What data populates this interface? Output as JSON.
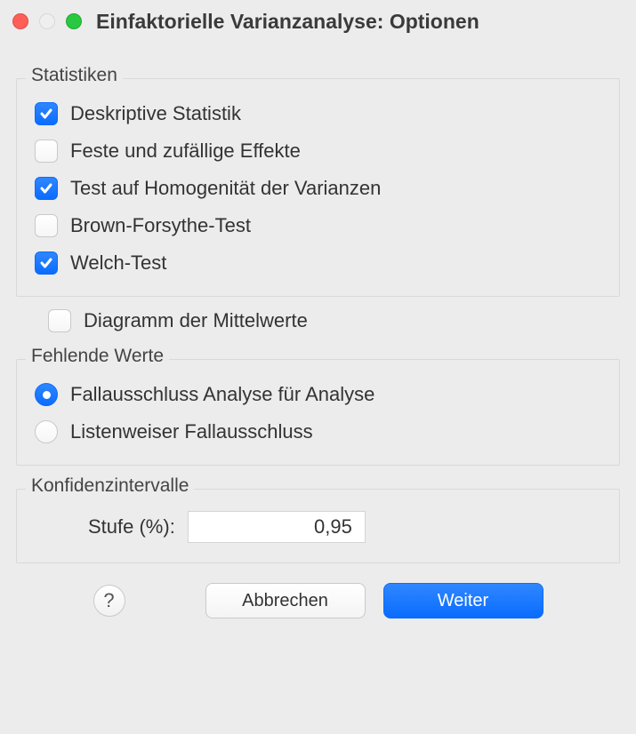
{
  "window": {
    "title": "Einfaktorielle Varianzanalyse: Optionen"
  },
  "groups": {
    "statistics": {
      "label": "Statistiken",
      "options": {
        "descriptive": {
          "label": "Deskriptive Statistik",
          "checked": true
        },
        "fixed_random": {
          "label": "Feste und zufällige Effekte",
          "checked": false
        },
        "homogeneity": {
          "label": "Test auf Homogenität der Varianzen",
          "checked": true
        },
        "brown_forsythe": {
          "label": "Brown-Forsythe-Test",
          "checked": false
        },
        "welch": {
          "label": "Welch-Test",
          "checked": true
        }
      }
    },
    "means_plot": {
      "label": "Diagramm der Mittelwerte",
      "checked": false
    },
    "missing": {
      "label": "Fehlende Werte",
      "options": {
        "analysis_by_analysis": {
          "label": "Fallausschluss Analyse für Analyse",
          "checked": true
        },
        "listwise": {
          "label": "Listenweiser Fallausschluss",
          "checked": false
        }
      }
    },
    "confidence": {
      "label": "Konfidenzintervalle",
      "level_label": "Stufe (%):",
      "level_value": "0,95"
    }
  },
  "buttons": {
    "help": "?",
    "cancel": "Abbrechen",
    "continue": "Weiter"
  }
}
